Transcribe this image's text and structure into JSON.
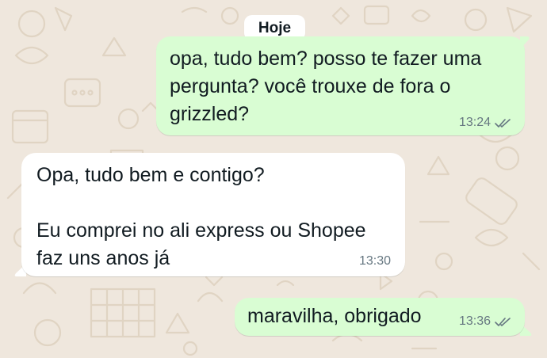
{
  "chat": {
    "date_divider": "Hoje",
    "messages": [
      {
        "direction": "outgoing",
        "text": "opa, tudo bem? posso te fazer uma\npergunta? você trouxe de fora o\ngrizzled?",
        "time": "13:24",
        "status": "read-ticks"
      },
      {
        "direction": "incoming",
        "text": "Opa, tudo bem e contigo?\n\nEu comprei no ali express ou Shopee\nfaz uns anos já",
        "time": "13:30"
      },
      {
        "direction": "outgoing",
        "text": "maravilha, obrigado",
        "time": "13:36",
        "status": "read-ticks"
      }
    ]
  },
  "colors": {
    "wallpaper": "#efe7dd",
    "outgoing_bubble": "#d9fdd3",
    "incoming_bubble": "#ffffff",
    "text": "#111b21",
    "meta_text": "#667781"
  },
  "icons": {
    "read_receipt": "double-check-icon",
    "wallpaper_doodles": "doodle-pattern"
  }
}
